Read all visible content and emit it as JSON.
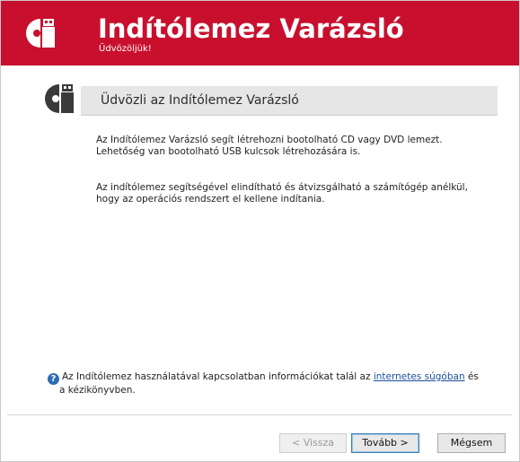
{
  "header": {
    "title": "Indítólemez Varázsló",
    "subtitle": "Üdvözöljük!",
    "icon": "disc-usb-icon",
    "background": "#c8102e"
  },
  "section": {
    "title": "Üdvözli az Indítólemez Varázsló",
    "icon": "disc-usb-icon"
  },
  "body": {
    "p1_line1": "Az Indítólemez Varázsló segít létrehozni bootolható CD vagy DVD lemezt.",
    "p1_line2": "Lehetőség van bootolható USB kulcsok létrehozására is.",
    "p2_line1": "Az indítólemez segítségével elindítható és átvizsgálható a számítógép anélkül,",
    "p2_line2": "hogy az operációs rendszert el kellene indítania."
  },
  "help": {
    "icon": "help-icon",
    "text_before": "Az Indítólemez használatával kapcsolatban információkat talál az ",
    "link": "internetes súgóban",
    "text_after": " és",
    "line2": "a kézikönyvben."
  },
  "buttons": {
    "back": "< Vissza",
    "next": "Tovább >",
    "cancel": "Mégsem"
  }
}
